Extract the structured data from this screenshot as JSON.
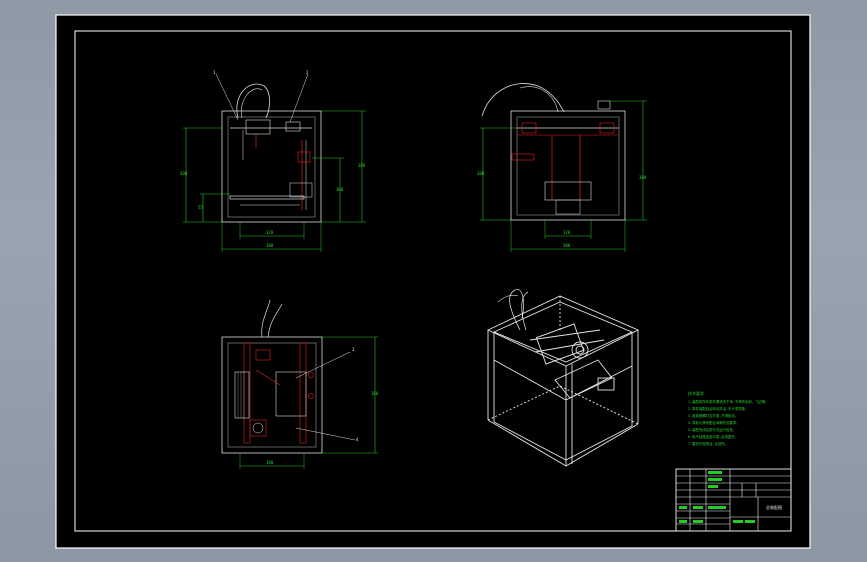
{
  "colors": {
    "background": "#9aa4b0",
    "paper": "#000000",
    "frame": "#ffffff",
    "dimension": "#22cc22",
    "red": "#e02020",
    "white": "#f0f0f0"
  },
  "sheet": {
    "title_block_title": "总装配图"
  },
  "views": {
    "front": {
      "dim_width": "380",
      "dim_width_inner": "320",
      "dim_height": "380",
      "dim_height_inner": "300",
      "dim_low": "55",
      "balloon_1": "1",
      "balloon_2": "2"
    },
    "side": {
      "dim_width": "380",
      "dim_width_inner": "320",
      "dim_height": "380"
    },
    "top": {
      "dim_width": "380",
      "dim_height": "380",
      "balloon_3": "3",
      "balloon_4": "4"
    }
  },
  "notes": {
    "heading": "技术要求",
    "lines": [
      "1.装配前所有零件需清洗干净,不得有毛刺、飞边等。",
      "2.零件装配后应转动灵活,无卡滞现象。",
      "3.各紧固螺钉应拧紧,不得松动。",
      "4.导轨与滑块配合间隙符合要求。",
      "5.装配完成后进行试运行检查。",
      "6.电气线路连接可靠,走线整齐。",
      "7.整机外观清洁,无划伤。"
    ]
  }
}
